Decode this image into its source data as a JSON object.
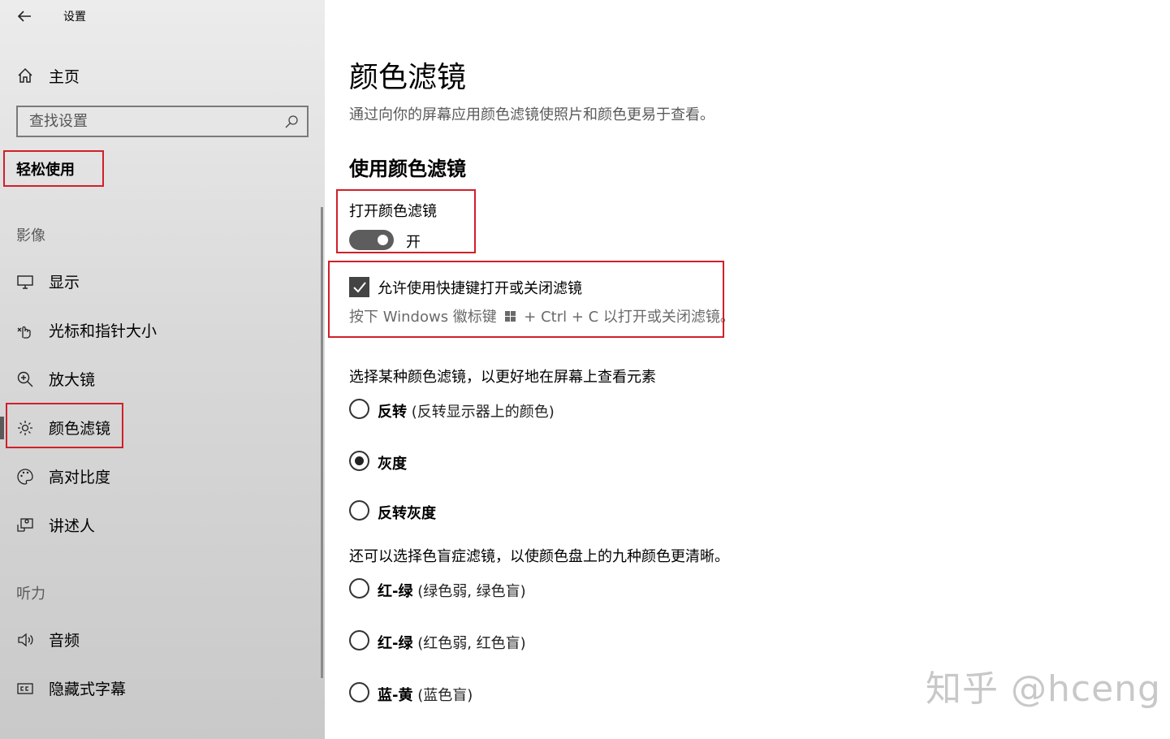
{
  "app": {
    "title": "设置",
    "back_icon": "back-arrow-icon"
  },
  "sidebar": {
    "home_label": "主页",
    "search_placeholder": "查找设置",
    "category_title": "轻松使用",
    "sections": [
      {
        "header": "影像",
        "items": [
          {
            "label": "显示",
            "icon": "monitor-icon"
          },
          {
            "label": "光标和指针大小",
            "icon": "pointer-hand-icon"
          },
          {
            "label": "放大镜",
            "icon": "magnifier-icon"
          },
          {
            "label": "颜色滤镜",
            "icon": "sun-icon",
            "selected": true
          },
          {
            "label": "高对比度",
            "icon": "palette-icon"
          },
          {
            "label": "讲述人",
            "icon": "narrator-icon"
          }
        ]
      },
      {
        "header": "听力",
        "items": [
          {
            "label": "音频",
            "icon": "speaker-icon"
          },
          {
            "label": "隐藏式字幕",
            "icon": "closed-caption-icon"
          }
        ]
      }
    ]
  },
  "main": {
    "title": "颜色滤镜",
    "description": "通过向你的屏幕应用颜色滤镜使照片和颜色更易于查看。",
    "subtitle": "使用颜色滤镜",
    "toggle": {
      "label": "打开颜色滤镜",
      "state_text": "开",
      "on": true
    },
    "shortcut": {
      "checkbox_label": "允许使用快捷键打开或关闭滤镜",
      "checked": true,
      "hint_before": "按下 Windows 徽标键",
      "hint_after": "+ Ctrl + C 以打开或关闭滤镜。"
    },
    "filter_prompt": "选择某种颜色滤镜，以更好地在屏幕上查看元素",
    "filters": [
      {
        "name": "反转",
        "desc": "(反转显示器上的颜色)",
        "selected": false
      },
      {
        "name": "灰度",
        "desc": "",
        "selected": true
      },
      {
        "name": "反转灰度",
        "desc": "",
        "selected": false
      }
    ],
    "colorblind_prompt": "还可以选择色盲症滤镜，以使颜色盘上的九种颜色更清晰。",
    "colorblind_filters": [
      {
        "name": "红-绿",
        "desc": "(绿色弱, 绿色盲)",
        "selected": false
      },
      {
        "name": "红-绿",
        "desc": "(红色弱, 红色盲)",
        "selected": false
      },
      {
        "name": "蓝-黄",
        "desc": "(蓝色盲)",
        "selected": false
      }
    ]
  },
  "watermark": "知乎 @hceng",
  "colors": {
    "highlight_box": "#d0202a",
    "toggle_on": "#5d5d5d",
    "sidebar_bg": "#d9d9d9"
  }
}
